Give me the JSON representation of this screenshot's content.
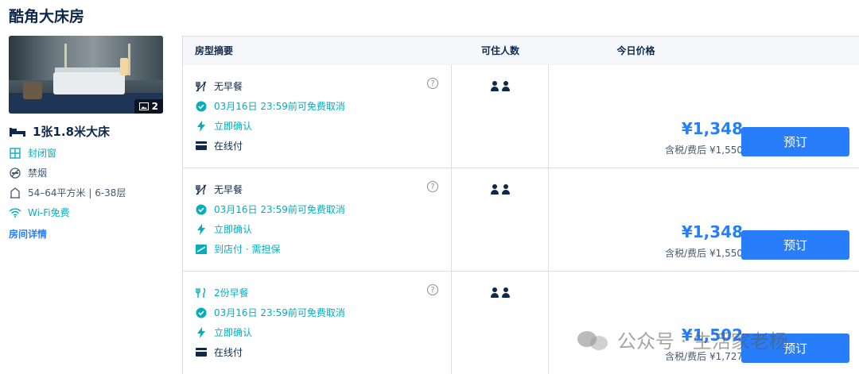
{
  "room_title": "酷角大床房",
  "photo": {
    "count": "2"
  },
  "bed": {
    "label": "1张1.8米大床"
  },
  "attributes": [
    {
      "icon": "window-icon",
      "text": "封闭窗",
      "green": true
    },
    {
      "icon": "no-smoking-icon",
      "text": "禁烟",
      "green": false
    },
    {
      "icon": "area-icon",
      "text": "54–64平方米 | 6-38层",
      "green": false
    },
    {
      "icon": "wifi-icon",
      "text": "Wi-Fi免费",
      "green": true
    }
  ],
  "detail_link": "房间详情",
  "table": {
    "headers": {
      "summary": "房型摘要",
      "occupancy": "可住人数",
      "price": "今日价格"
    },
    "rows": [
      {
        "meal": "无早餐",
        "meal_green": false,
        "cancel": "03月16日 23:59前可免费取消",
        "confirm": "立即确认",
        "payment": "在线付",
        "payment_icon": "card-icon",
        "payment_green": false,
        "price": "¥1,348",
        "tax": "含税/费后 ¥1,550",
        "book": "预订"
      },
      {
        "meal": "无早餐",
        "meal_green": false,
        "cancel": "03月16日 23:59前可免费取消",
        "confirm": "立即确认",
        "payment": "到店付 · 需担保",
        "payment_icon": "pay-at-hotel-icon",
        "payment_green": true,
        "price": "¥1,348",
        "tax": "含税/费后 ¥1,550",
        "book": "预订"
      },
      {
        "meal": "2份早餐",
        "meal_green": true,
        "cancel": "03月16日 23:59前可免费取消",
        "confirm": "立即确认",
        "payment": "在线付",
        "payment_icon": "card-icon",
        "payment_green": false,
        "price": "¥1,502",
        "tax": "含税/费后 ¥1,727",
        "book": "预订"
      }
    ]
  },
  "watermark": "公众号 · 生活家老杨",
  "colors": {
    "accent": "#287dfa",
    "green": "#06aebd",
    "text": "#0f294d"
  }
}
